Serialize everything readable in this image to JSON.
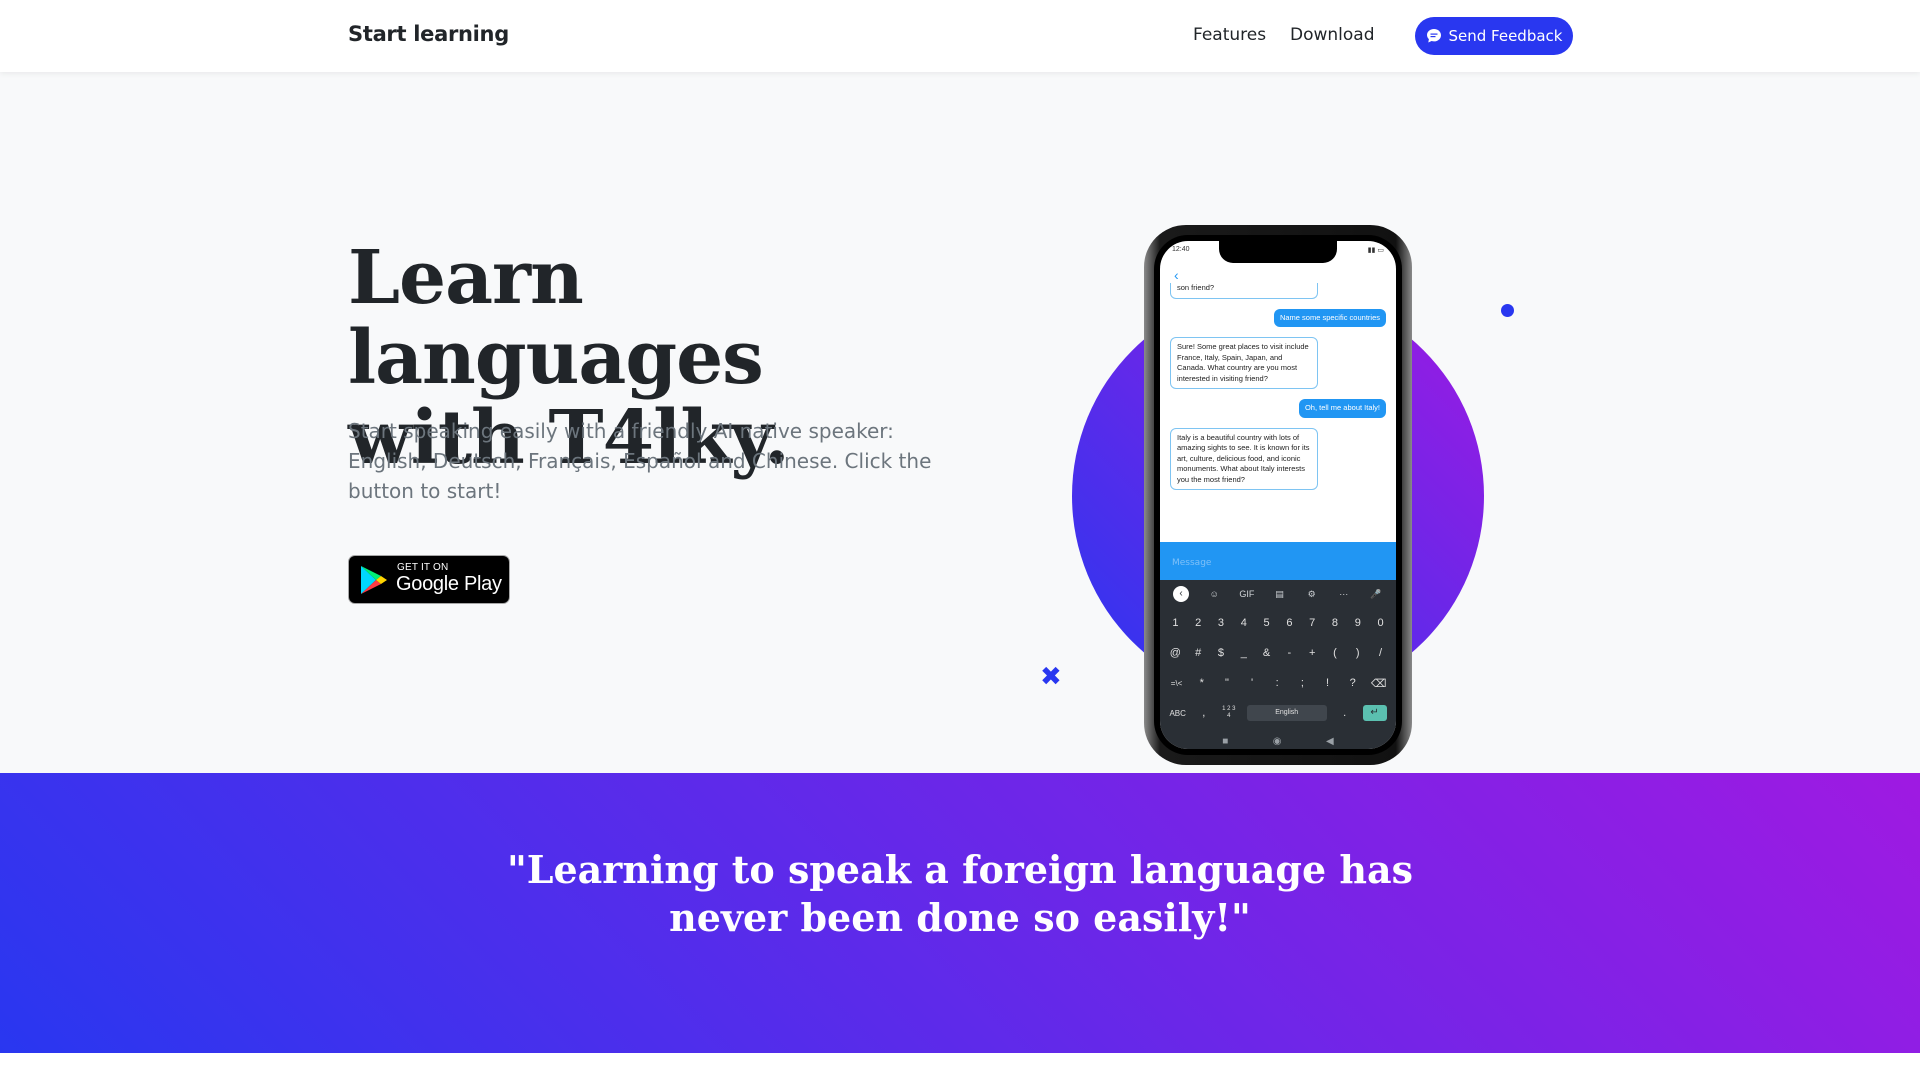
{
  "navbar": {
    "brand": "Start learning",
    "links": [
      "Features",
      "Download"
    ],
    "feedback_button": "Send Feedback"
  },
  "hero": {
    "title_line1": "Learn languages",
    "title_line2": "with T4lky.",
    "subtitle": "Start speaking easily with a friendly AI native speaker: English, Deutsch, Français, Español and Chinese. Click the button to start!",
    "store_badge": {
      "small": "GET IT ON",
      "big": "Google Play"
    }
  },
  "phone": {
    "status_time": "12:40",
    "messages": [
      {
        "from": "bot",
        "text": "son friend?",
        "partial": true
      },
      {
        "from": "me",
        "text": "Name some specific countries"
      },
      {
        "from": "bot",
        "text": "Sure! Some great places to visit include France, Italy, Spain, Japan, and Canada. What country are you most interested in visiting friend?"
      },
      {
        "from": "me",
        "text": "Oh, tell me about Italy!"
      },
      {
        "from": "bot",
        "text": "Italy is a beautiful country with lots of amazing sights to see. It is known for its art, culture, delicious food, and iconic monuments. What about Italy interests you the most friend?"
      }
    ],
    "message_placeholder": "Message",
    "keyboard": {
      "tools": [
        "‹",
        "☺",
        "GIF",
        "▤",
        "⚙",
        "···",
        "🎤"
      ],
      "row1": [
        "1",
        "2",
        "3",
        "4",
        "5",
        "6",
        "7",
        "8",
        "9",
        "0"
      ],
      "row2": [
        "@",
        "#",
        "$",
        "_",
        "&",
        "-",
        "+",
        "(",
        ")",
        "/"
      ],
      "row3": [
        "=\\<",
        "*",
        "\"",
        "'",
        ":",
        ";",
        "!",
        "?",
        "⌫"
      ],
      "row4_left": [
        "ABC",
        ",",
        "1 2 3 4"
      ],
      "space_label": "English",
      "row4_right": [
        "."
      ],
      "enter": "↵",
      "nav": [
        "■",
        "◉",
        "◀"
      ]
    }
  },
  "quote": {
    "line1": "\"Learning to speak a foreign language has",
    "line2": "never been done so easily!\""
  },
  "colors": {
    "primary": "#2937f0",
    "secondary": "#9f1ae2",
    "chat_blue": "#2196f3"
  }
}
